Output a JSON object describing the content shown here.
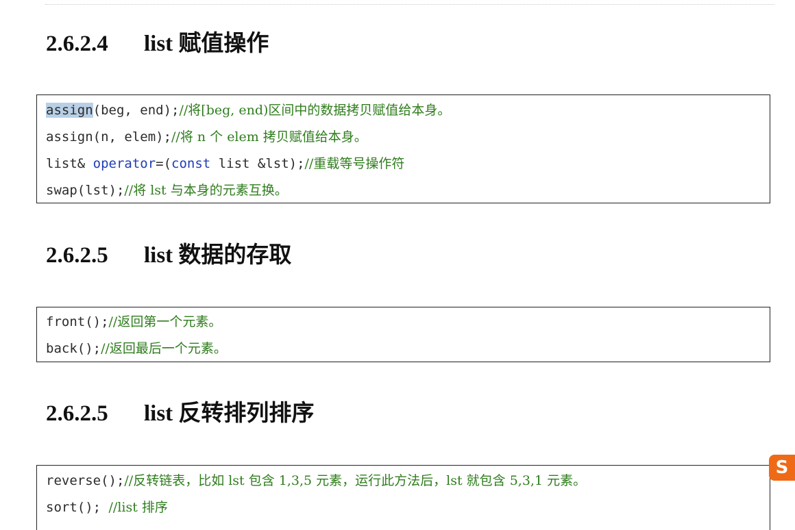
{
  "sections": [
    {
      "number": "2.6.2.4",
      "title": "list 赋值操作",
      "lines": [
        {
          "code_prefix": "",
          "highlight": "assign",
          "code": "(beg, end);",
          "comment": "//将[beg, end)区间中的数据拷贝赋值给本身。"
        },
        {
          "code": "assign(n, elem);",
          "comment": "//将 n 个 elem 拷贝赋值给本身。"
        },
        {
          "code_pre": "list& ",
          "keyword": "operator",
          "code_post": "=(",
          "keyword2": "const",
          "code_post2": " list &lst);",
          "comment": "//重载等号操作符"
        },
        {
          "code": "swap(lst);",
          "comment": "//将 lst 与本身的元素互换。"
        }
      ]
    },
    {
      "number": "2.6.2.5",
      "title": "list 数据的存取",
      "lines": [
        {
          "code": "front();",
          "comment": "//返回第一个元素。"
        },
        {
          "code": "back();",
          "comment": "//返回最后一个元素。"
        }
      ]
    },
    {
      "number": "2.6.2.5",
      "title": "list 反转排列排序",
      "lines": [
        {
          "code": "reverse();",
          "comment": "//反转链表，比如 lst 包含 1,3,5 元素，运行此方法后，lst 就包含 5,3,1 元素。"
        },
        {
          "code": "sort(); ",
          "comment": "//list 排序"
        }
      ]
    }
  ],
  "overlay": {
    "ime_logo_icon": "sogou-ime-icon",
    "ime_logo_text": "S"
  },
  "colors": {
    "comment": "#2f7d1d",
    "keyword": "#1f3db3",
    "selection": "#b8cfe6",
    "ime_logo": "#ef6a17"
  }
}
